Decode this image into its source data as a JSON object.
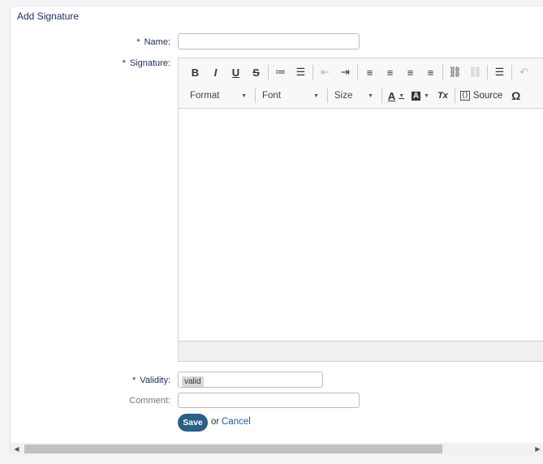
{
  "form": {
    "title": "Add Signature",
    "required_marker": "*",
    "name_label": "Name:",
    "name_value": "",
    "signature_label": "Signature:",
    "validity_label": "Validity:",
    "validity_value": "valid",
    "comment_label": "Comment:",
    "comment_value": "",
    "save_label": "Save",
    "or_text": "or",
    "cancel_label": "Cancel"
  },
  "editor": {
    "toolbar_row1": [
      {
        "name": "bold-button",
        "glyph": "B"
      },
      {
        "name": "italic-button",
        "glyph": "I"
      },
      {
        "name": "underline-button",
        "glyph": "U"
      },
      {
        "name": "strikethrough-button",
        "glyph": "S"
      },
      {
        "name": "numbered-list-button",
        "glyph": "≔"
      },
      {
        "name": "bulleted-list-button",
        "glyph": "☰"
      },
      {
        "name": "decrease-indent-button",
        "glyph": "⇤"
      },
      {
        "name": "increase-indent-button",
        "glyph": "⇥"
      },
      {
        "name": "align-left-button",
        "glyph": "≡"
      },
      {
        "name": "align-center-button",
        "glyph": "≡"
      },
      {
        "name": "align-right-button",
        "glyph": "≡"
      },
      {
        "name": "justify-button",
        "glyph": "≡"
      },
      {
        "name": "link-button",
        "glyph": "⛓"
      },
      {
        "name": "unlink-button",
        "glyph": "⛓"
      },
      {
        "name": "horizontal-line-button",
        "glyph": "☰"
      },
      {
        "name": "undo-button",
        "glyph": "↶"
      }
    ],
    "format_label": "Format",
    "font_label": "Font",
    "size_label": "Size",
    "text_color_glyph": "A",
    "bg_color_glyph": "A",
    "remove_format_glyph": "Tx",
    "source_label": "Source",
    "special_char_glyph": "Ω"
  }
}
